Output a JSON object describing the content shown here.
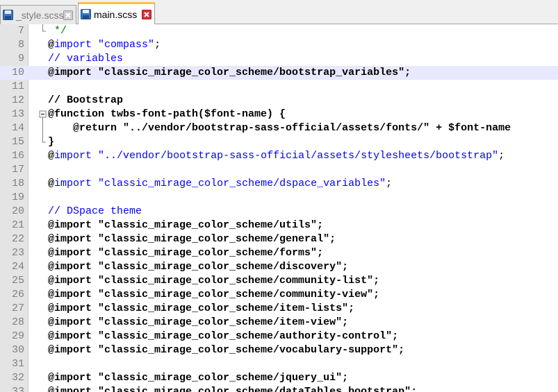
{
  "tabs": [
    {
      "label": "_style.scss",
      "active": false
    },
    {
      "label": "main.scss",
      "active": true
    }
  ],
  "lines": [
    {
      "n": "7",
      "code": [
        {
          "t": " */",
          "c": "comment"
        }
      ],
      "fold": "end"
    },
    {
      "n": "8",
      "code": [
        {
          "t": "@",
          "c": "at"
        },
        {
          "t": "import",
          "c": "cs"
        },
        {
          "t": " ",
          "c": "plain"
        },
        {
          "t": "\"compass\"",
          "c": "str2"
        },
        {
          "t": ";",
          "c": "plainn"
        }
      ]
    },
    {
      "n": "9",
      "code": [
        {
          "t": "// variables",
          "c": "cs"
        }
      ]
    },
    {
      "n": "10",
      "code": [
        {
          "t": "@import ",
          "c": "plain"
        },
        {
          "t": "\"classic_mirage_color_scheme/bootstrap_variables\"",
          "c": "plain"
        },
        {
          "t": ";",
          "c": "plain"
        }
      ],
      "current": true
    },
    {
      "n": "11",
      "code": []
    },
    {
      "n": "12",
      "code": [
        {
          "t": "// Bootstrap",
          "c": "plain"
        }
      ]
    },
    {
      "n": "13",
      "code": [
        {
          "t": "@function twbs-font-path($font-name) {",
          "c": "plain"
        }
      ],
      "fold": "start"
    },
    {
      "n": "14",
      "code": [
        {
          "t": "    @return \"../vendor/bootstrap-sass-official/assets/fonts/\" + $font-name",
          "c": "plain"
        }
      ],
      "fold": "mid"
    },
    {
      "n": "15",
      "code": [
        {
          "t": "}",
          "c": "plain"
        }
      ],
      "fold": "end"
    },
    {
      "n": "16",
      "code": [
        {
          "t": "@",
          "c": "at"
        },
        {
          "t": "import",
          "c": "cs"
        },
        {
          "t": " ",
          "c": "plain"
        },
        {
          "t": "\"../vendor/bootstrap-sass-official/assets/stylesheets/bootstrap\"",
          "c": "str2"
        },
        {
          "t": ";",
          "c": "plainn"
        }
      ]
    },
    {
      "n": "17",
      "code": []
    },
    {
      "n": "18",
      "code": [
        {
          "t": "@",
          "c": "at"
        },
        {
          "t": "import",
          "c": "cs"
        },
        {
          "t": " ",
          "c": "plain"
        },
        {
          "t": "\"classic_mirage_color_scheme/dspace_variables\"",
          "c": "str2"
        },
        {
          "t": ";",
          "c": "plainn"
        }
      ]
    },
    {
      "n": "19",
      "code": []
    },
    {
      "n": "20",
      "code": [
        {
          "t": "// ",
          "c": "cs"
        },
        {
          "t": "DSpace theme",
          "c": "cs"
        }
      ]
    },
    {
      "n": "21",
      "code": [
        {
          "t": "@import \"classic_mirage_color_scheme/utils\";",
          "c": "plain"
        }
      ]
    },
    {
      "n": "22",
      "code": [
        {
          "t": "@import \"classic_mirage_color_scheme/general\";",
          "c": "plain"
        }
      ]
    },
    {
      "n": "23",
      "code": [
        {
          "t": "@import \"classic_mirage_color_scheme/forms\";",
          "c": "plain"
        }
      ]
    },
    {
      "n": "24",
      "code": [
        {
          "t": "@import \"classic_mirage_color_scheme/discovery\";",
          "c": "plain"
        }
      ]
    },
    {
      "n": "25",
      "code": [
        {
          "t": "@import \"classic_mirage_color_scheme/community-list\";",
          "c": "plain"
        }
      ]
    },
    {
      "n": "26",
      "code": [
        {
          "t": "@import \"classic_mirage_color_scheme/community-view\";",
          "c": "plain"
        }
      ]
    },
    {
      "n": "27",
      "code": [
        {
          "t": "@import \"classic_mirage_color_scheme/item-lists\";",
          "c": "plain"
        }
      ]
    },
    {
      "n": "28",
      "code": [
        {
          "t": "@import \"classic_mirage_color_scheme/item-view\";",
          "c": "plain"
        }
      ]
    },
    {
      "n": "29",
      "code": [
        {
          "t": "@import \"classic_mirage_color_scheme/authority-control\";",
          "c": "plain"
        }
      ]
    },
    {
      "n": "30",
      "code": [
        {
          "t": "@import \"classic_mirage_color_scheme/vocabulary-support\";",
          "c": "plain"
        }
      ]
    },
    {
      "n": "31",
      "code": []
    },
    {
      "n": "32",
      "code": [
        {
          "t": "@import \"classic_mirage_color_scheme/jquery_ui\";",
          "c": "plain"
        }
      ]
    },
    {
      "n": "33",
      "code": [
        {
          "t": "@import \"classic_mirage_color_scheme/dataTables_bootstrap\";",
          "c": "plain"
        }
      ]
    }
  ],
  "colors": {
    "accent_tab": "#fbc04a",
    "current_line": "#e8e8ff",
    "close_red": "#d9303a"
  },
  "icons": {
    "file": "save-disk-icon",
    "close": "close-icon",
    "fold": "fold-box-icon"
  }
}
